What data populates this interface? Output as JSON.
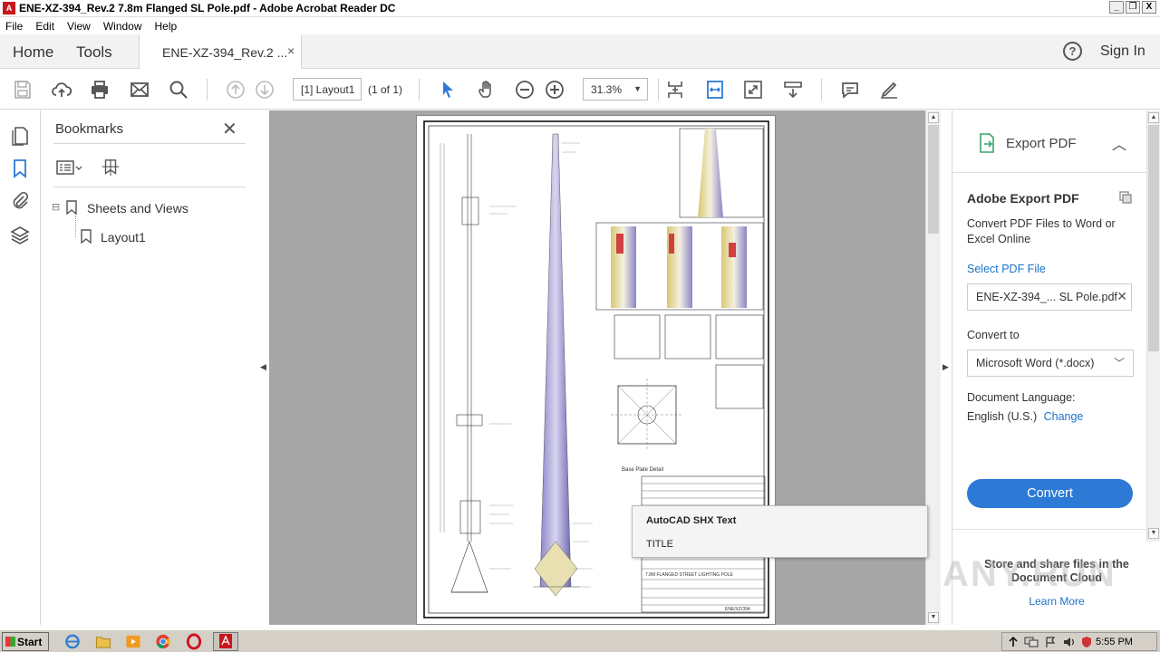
{
  "window": {
    "title": "ENE-XZ-394_Rev.2  7.8m Flanged SL Pole.pdf - Adobe Acrobat Reader DC",
    "controls": [
      "_",
      "❐",
      "X"
    ]
  },
  "menu": [
    "File",
    "Edit",
    "View",
    "Window",
    "Help"
  ],
  "tabs": {
    "home": "Home",
    "tools": "Tools",
    "document": "ENE-XZ-394_Rev.2 ...",
    "close": "×",
    "help": "?",
    "signin": "Sign In"
  },
  "toolbar": {
    "page_value": "[1] Layout1",
    "page_count": "(1 of 1)",
    "zoom_value": "31.3%"
  },
  "bookmarks": {
    "title": "Bookmarks",
    "close": "✕",
    "items": [
      {
        "label": "Sheets and Views",
        "expander": "⊟"
      },
      {
        "label": "Layout1"
      }
    ]
  },
  "tooltip": {
    "line1": "AutoCAD SHX Text",
    "line2": "TITLE"
  },
  "export_panel": {
    "header": "Export PDF",
    "title": "Adobe Export PDF",
    "description": "Convert PDF Files to Word or Excel Online",
    "select_label": "Select PDF File",
    "file_name": "ENE-XZ-394_... SL Pole.pdf",
    "convert_to_label": "Convert to",
    "convert_to_value": "Microsoft Word (*.docx)",
    "language_label": "Document Language:",
    "language_value": "English (U.S.)",
    "change_label": "Change",
    "convert_button": "Convert",
    "store_text": "Store and share files in the Document Cloud",
    "learn_more": "Learn More"
  },
  "drawing": {
    "title_text": "7.8M FLANGED STREET LIGHTING POLE",
    "drawing_number": "ENE/XZ/394",
    "base_plate_caption": "Base Plate Detail"
  },
  "taskbar": {
    "start": "Start",
    "clock": "5:55 PM"
  },
  "watermark": "ANY.RUN",
  "colors": {
    "accent": "#2c7ad6",
    "link": "#1a73c9",
    "acrobat_red": "#c8161d"
  }
}
